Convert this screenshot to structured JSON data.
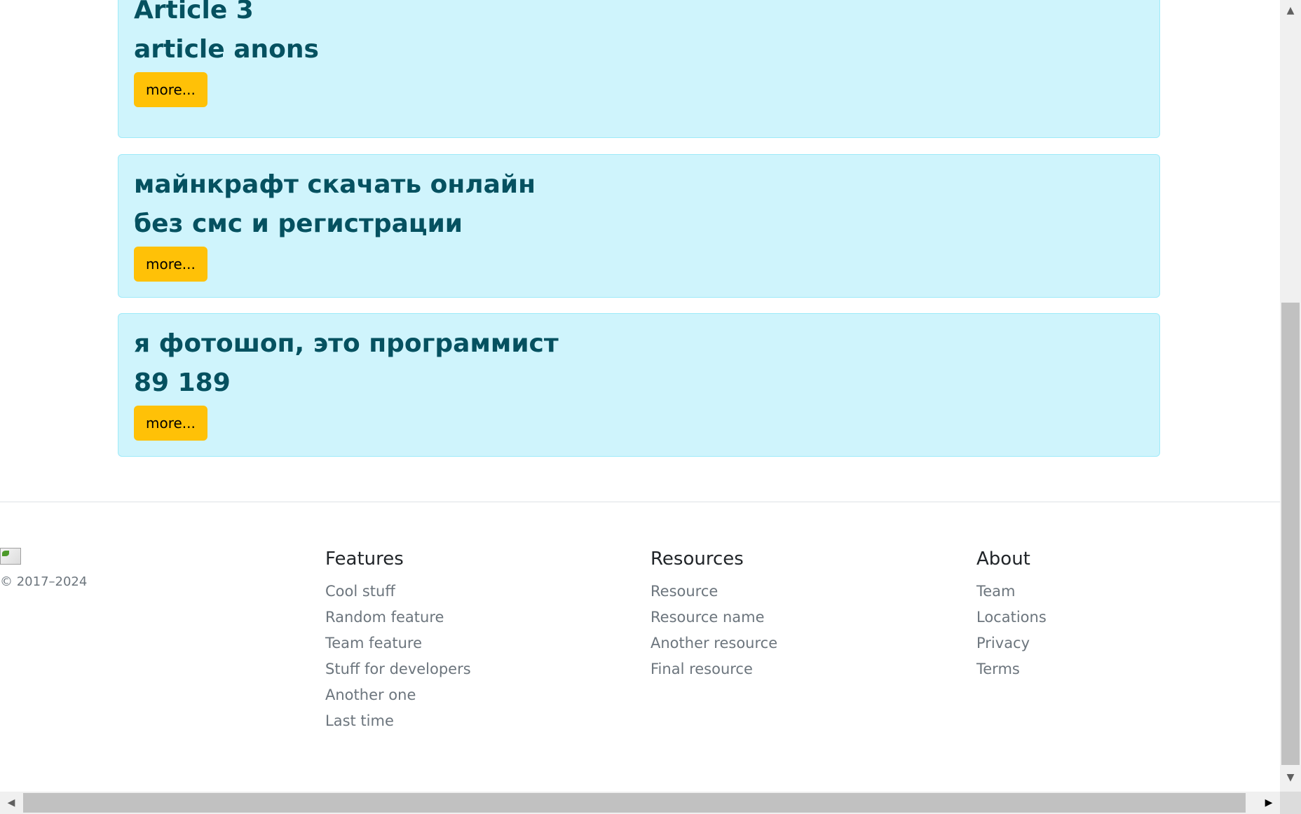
{
  "articles": [
    {
      "title": "Article 3",
      "anons": "article anons",
      "button": "more..."
    },
    {
      "title": "майнкрафт скачать онлайн",
      "anons": "без смс и регистрации",
      "button": "more..."
    },
    {
      "title": "я фотошоп, это программист",
      "anons": "89 189",
      "button": "more..."
    }
  ],
  "footer": {
    "copyright": "© 2017–2024",
    "columns": [
      {
        "heading": "Features",
        "links": [
          "Cool stuff",
          "Random feature",
          "Team feature",
          "Stuff for developers",
          "Another one",
          "Last time"
        ]
      },
      {
        "heading": "Resources",
        "links": [
          "Resource",
          "Resource name",
          "Another resource",
          "Final resource"
        ]
      },
      {
        "heading": "About",
        "links": [
          "Team",
          "Locations",
          "Privacy",
          "Terms"
        ]
      }
    ]
  },
  "icons": {
    "scroll_up": "▲",
    "scroll_down": "▼",
    "scroll_left": "◀",
    "scroll_right": "▶"
  },
  "colors": {
    "card_bg": "#cff4fc",
    "card_text": "#055160",
    "button_bg": "#ffc107"
  }
}
